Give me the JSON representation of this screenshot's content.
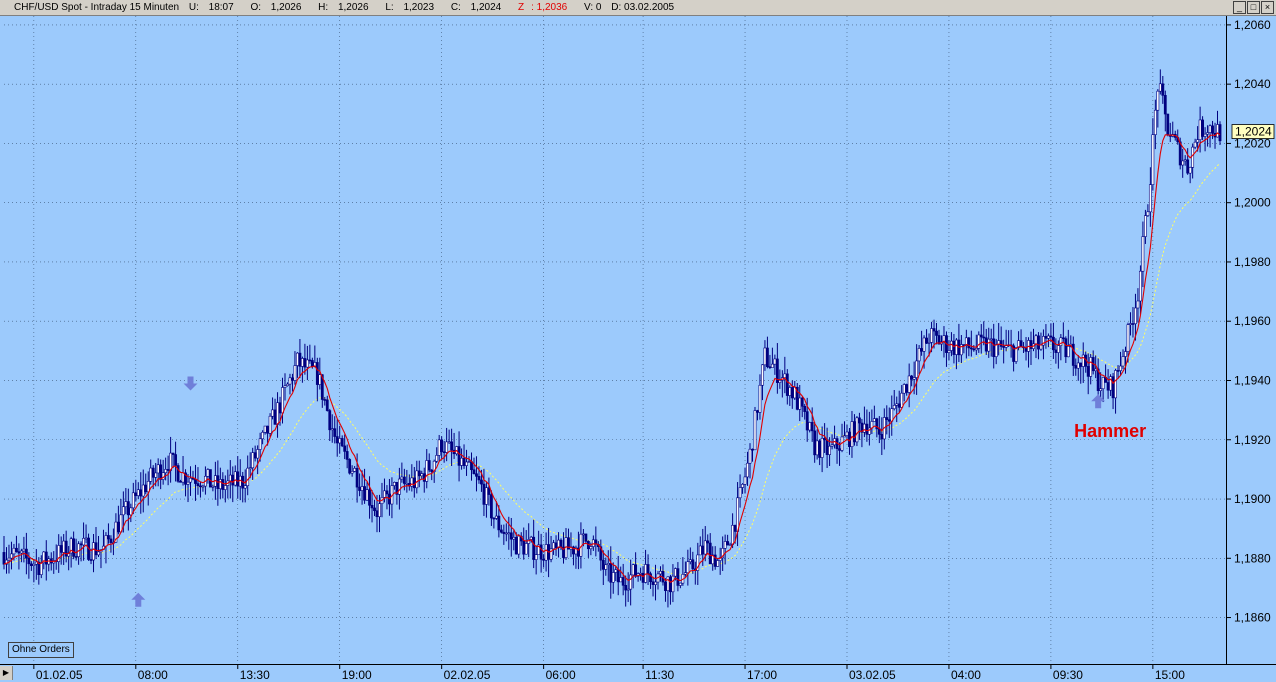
{
  "header": {
    "symbol": "CHF/USD Spot - Intraday 15 Minuten",
    "fields": [
      {
        "label": "U:",
        "value": "18:07"
      },
      {
        "label": "O:",
        "value": "1,2026"
      },
      {
        "label": "H:",
        "value": "1,2026"
      },
      {
        "label": "L:",
        "value": "1,2023"
      },
      {
        "label": "C:",
        "value": "1,2024"
      }
    ],
    "z_label": "Z",
    "z_value": ": 1,2036",
    "v_field": "V: 0",
    "d_field": "D: 03.02.2005"
  },
  "window_controls": [
    "_",
    "□",
    "×"
  ],
  "orders_button": "Ohne Orders",
  "colors": {
    "background": "#9ccafc",
    "candle": "#000080",
    "ma_fast": "#e00000",
    "ma_slow": "#ffff66",
    "arrow": "#6f7fd9",
    "annotation": "#e00000",
    "grid": "#3a5577"
  },
  "chart_data": {
    "type": "candlestick",
    "ylim": [
      1.1845,
      1.2063
    ],
    "y_ticks": [
      "1,2060",
      "1,2040",
      "1,2020",
      "1,2000",
      "1,1980",
      "1,1960",
      "1,1940",
      "1,1920",
      "1,1900",
      "1,1880",
      "1,1860"
    ],
    "y_tick_values": [
      1.206,
      1.204,
      1.202,
      1.2,
      1.198,
      1.196,
      1.194,
      1.192,
      1.19,
      1.188,
      1.186
    ],
    "x_ticks": [
      "01.02.05",
      "08:00",
      "13:30",
      "19:00",
      "02.02.05",
      "06:00",
      "11:30",
      "17:00",
      "03.02.05",
      "04:00",
      "09:30",
      "15:00"
    ],
    "last_price_label": "1,2024",
    "price_path": [
      [
        0,
        1.1882
      ],
      [
        14,
        1.1878
      ],
      [
        28,
        1.1884
      ],
      [
        40,
        1.1883
      ],
      [
        46,
        1.1892
      ],
      [
        58,
        1.1906
      ],
      [
        66,
        1.1913
      ],
      [
        72,
        1.1908
      ],
      [
        80,
        1.1907
      ],
      [
        86,
        1.1904
      ],
      [
        96,
        1.1906
      ],
      [
        102,
        1.1916
      ],
      [
        110,
        1.193
      ],
      [
        118,
        1.1946
      ],
      [
        126,
        1.1942
      ],
      [
        134,
        1.1918
      ],
      [
        142,
        1.1908
      ],
      [
        150,
        1.1896
      ],
      [
        158,
        1.1904
      ],
      [
        166,
        1.1906
      ],
      [
        172,
        1.1912
      ],
      [
        176,
        1.1919
      ],
      [
        184,
        1.1912
      ],
      [
        192,
        1.1904
      ],
      [
        198,
        1.1892
      ],
      [
        206,
        1.1885
      ],
      [
        214,
        1.1883
      ],
      [
        222,
        1.1882
      ],
      [
        230,
        1.1884
      ],
      [
        236,
        1.1887
      ],
      [
        242,
        1.1875
      ],
      [
        248,
        1.1872
      ],
      [
        256,
        1.1876
      ],
      [
        264,
        1.1874
      ],
      [
        268,
        1.1872
      ],
      [
        276,
        1.1876
      ],
      [
        282,
        1.1884
      ],
      [
        288,
        1.1878
      ],
      [
        294,
        1.1893
      ],
      [
        300,
        1.1915
      ],
      [
        306,
        1.1948
      ],
      [
        312,
        1.1942
      ],
      [
        318,
        1.1935
      ],
      [
        326,
        1.1918
      ],
      [
        332,
        1.1916
      ],
      [
        338,
        1.192
      ],
      [
        346,
        1.1926
      ],
      [
        352,
        1.1923
      ],
      [
        358,
        1.193
      ],
      [
        364,
        1.1941
      ],
      [
        372,
        1.1955
      ],
      [
        380,
        1.1952
      ],
      [
        388,
        1.1951
      ],
      [
        396,
        1.1952
      ],
      [
        404,
        1.195
      ],
      [
        412,
        1.1951
      ],
      [
        420,
        1.1952
      ],
      [
        428,
        1.195
      ],
      [
        436,
        1.1945
      ],
      [
        442,
        1.1938
      ],
      [
        446,
        1.1938
      ],
      [
        452,
        1.1955
      ],
      [
        456,
        1.197
      ],
      [
        460,
        1.2
      ],
      [
        464,
        1.204
      ],
      [
        468,
        1.2025
      ],
      [
        472,
        1.2018
      ],
      [
        476,
        1.2012
      ],
      [
        480,
        1.2024
      ],
      [
        484,
        1.2026
      ],
      [
        488,
        1.2024
      ]
    ],
    "annotations": [
      {
        "label": "Hammer",
        "at": 440,
        "price": 1.1927
      }
    ],
    "arrows_down": [
      {
        "at": 75,
        "price": 1.1939
      }
    ],
    "arrows_up": [
      {
        "at": 54,
        "price": 1.1866
      },
      {
        "at": 440,
        "price": 1.1933
      }
    ]
  }
}
